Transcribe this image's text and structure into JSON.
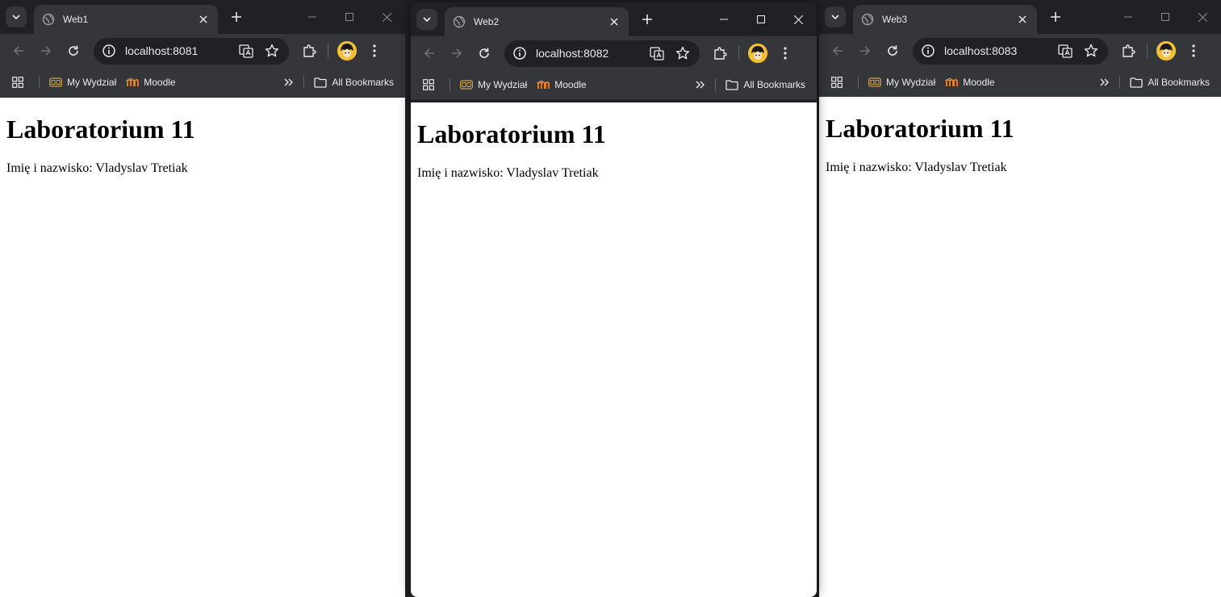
{
  "windows": [
    {
      "tab_title": "Web1",
      "url": "localhost:8081",
      "bookmarks": [
        {
          "label": "My Wydział",
          "icon": "folder-bookmark-icon"
        },
        {
          "label": "Moodle",
          "icon": "moodle-icon"
        }
      ],
      "all_bookmarks": "All Bookmarks",
      "page": {
        "heading": "Laboratorium 11",
        "text": "Imię i nazwisko: Vladyslav Tretiak"
      }
    },
    {
      "tab_title": "Web2",
      "url": "localhost:8082",
      "bookmarks": [
        {
          "label": "My Wydział",
          "icon": "folder-bookmark-icon"
        },
        {
          "label": "Moodle",
          "icon": "moodle-icon"
        }
      ],
      "all_bookmarks": "All Bookmarks",
      "page": {
        "heading": "Laboratorium 11",
        "text": "Imię i nazwisko: Vladyslav Tretiak"
      }
    },
    {
      "tab_title": "Web3",
      "url": "localhost:8083",
      "bookmarks": [
        {
          "label": "My Wydział",
          "icon": "folder-bookmark-icon"
        },
        {
          "label": "Moodle",
          "icon": "moodle-icon"
        }
      ],
      "all_bookmarks": "All Bookmarks",
      "page": {
        "heading": "Laboratorium 11",
        "text": "Imię i nazwisko: Vladyslav Tretiak"
      }
    }
  ],
  "colors": {
    "chrome_dark": "#202124",
    "chrome_toolbar": "#35363a",
    "text": "#e8eaed",
    "page_bg": "#ffffff",
    "moodle": "#f98012",
    "bookmark_folder": "#c8a14a"
  }
}
